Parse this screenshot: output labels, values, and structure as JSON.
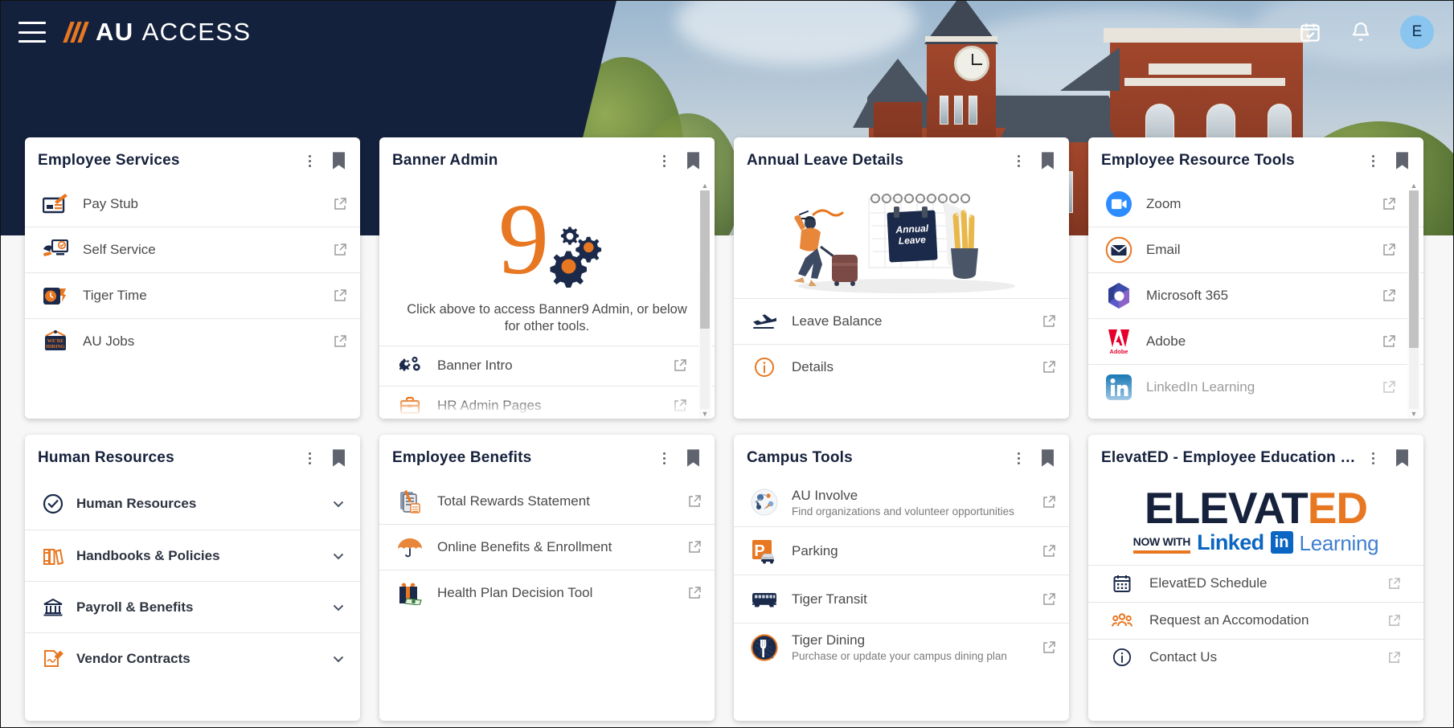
{
  "app": {
    "brand_bold": "AU",
    "brand_light": "ACCESS",
    "menu_icon": "hamburger-icon",
    "calendar_icon": "calendar-check-icon",
    "bell_icon": "notification-bell-icon",
    "avatar_initial": "E"
  },
  "colors": {
    "navy": "#14213d",
    "orange": "#e87722",
    "card_bg": "#ffffff",
    "page_bg": "#f7f7f8",
    "avatar_bg": "#8ac5ef"
  },
  "cards": [
    {
      "title": "Employee Services",
      "items": [
        {
          "label": "Pay Stub",
          "icon": "paystub-check-icon",
          "external": true
        },
        {
          "label": "Self Service",
          "icon": "self-service-monitor-icon",
          "external": true
        },
        {
          "label": "Tiger Time",
          "icon": "tiger-time-clock-icon",
          "external": true
        },
        {
          "label": "AU Jobs",
          "icon": "were-hiring-sign-icon",
          "external": true
        }
      ]
    },
    {
      "title": "Banner Admin",
      "logo": {
        "numeral": "9",
        "name": "banner9-gears-logo"
      },
      "note": "Click above to access Banner9 Admin, or below for other tools.",
      "items": [
        {
          "label": "Banner Intro",
          "icon": "gears-icon",
          "external": true
        },
        {
          "label": "HR Admin Pages",
          "icon": "briefcase-icon",
          "external": true
        }
      ],
      "scrollbar": true
    },
    {
      "title": "Annual Leave Details",
      "illustration": "annual-leave-traveler-illustration",
      "illustration_text": "Annual Leave",
      "items": [
        {
          "label": "Leave Balance",
          "icon": "airplane-takeoff-icon",
          "external": true
        },
        {
          "label": "Details",
          "icon": "info-circle-icon",
          "external": true
        }
      ]
    },
    {
      "title": "Employee Resource Tools",
      "items": [
        {
          "label": "Zoom",
          "icon": "zoom-logo-icon",
          "external": true
        },
        {
          "label": "Email",
          "icon": "email-envelope-icon",
          "external": true
        },
        {
          "label": "Microsoft 365",
          "icon": "microsoft-365-logo-icon",
          "external": true
        },
        {
          "label": "Adobe",
          "icon": "adobe-logo-icon",
          "external": true
        },
        {
          "label": "LinkedIn Learning",
          "icon": "linkedin-logo-icon",
          "external": true
        }
      ],
      "scrollbar": true
    },
    {
      "title": "Human Resources",
      "accordion": [
        {
          "label": "Human Resources",
          "icon": "check-circle-icon"
        },
        {
          "label": "Handbooks & Policies",
          "icon": "books-icon"
        },
        {
          "label": "Payroll & Benefits",
          "icon": "bank-icon"
        },
        {
          "label": "Vendor Contracts",
          "icon": "contract-signature-icon"
        }
      ]
    },
    {
      "title": "Employee Benefits",
      "items": [
        {
          "label": "Total Rewards Statement",
          "icon": "clipboard-pen-icon",
          "external": true
        },
        {
          "label": "Online Benefits & Enrollment",
          "icon": "umbrella-icon",
          "external": true
        },
        {
          "label": "Health Plan Decision Tool",
          "icon": "gift-money-icon",
          "external": true
        }
      ]
    },
    {
      "title": "Campus Tools",
      "items": [
        {
          "label": "AU Involve",
          "sub": "Find organizations and volunteer opportunities",
          "icon": "au-involve-icon",
          "external": true
        },
        {
          "label": "Parking",
          "icon": "parking-car-icon",
          "external": true
        },
        {
          "label": "Tiger Transit",
          "icon": "bus-icon",
          "external": true
        },
        {
          "label": "Tiger Dining",
          "sub": "Purchase or update your campus dining plan",
          "icon": "dining-fork-icon",
          "external": true
        }
      ]
    },
    {
      "title": "ElevatED - Employee Education C…",
      "logo": {
        "word_a": "ELEVAT",
        "word_b": "ED",
        "now_with": "NOW WITH",
        "linked": "Linked",
        "in": "in",
        "learning": "Learning"
      },
      "items": [
        {
          "label": "ElevatED Schedule",
          "icon": "calendar-icon",
          "external": true
        },
        {
          "label": "Request an Accomodation",
          "icon": "people-group-icon",
          "external": true
        },
        {
          "label": "Contact Us",
          "icon": "info-circle-icon",
          "external": true
        }
      ]
    }
  ]
}
